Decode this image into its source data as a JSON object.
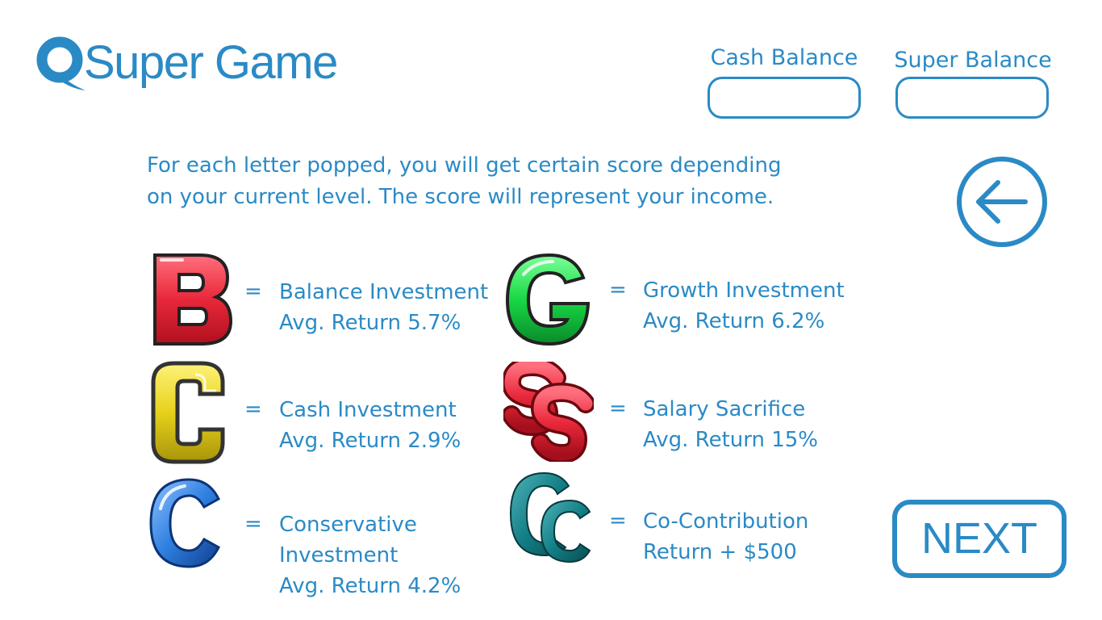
{
  "app": {
    "title": "Super Game"
  },
  "balances": {
    "cash_label": "Cash Balance",
    "cash_value": "",
    "super_label": "Super Balance",
    "super_value": ""
  },
  "intro": {
    "line1": "For each letter popped, you will get certain score depending",
    "line2": "on your current level. The score will represent your income."
  },
  "letters": [
    {
      "letter": "B",
      "icon": "letter-b-icon",
      "color": "#e8283a",
      "equals": "=",
      "lines": [
        "Balance Investment",
        "Avg. Return 5.7%"
      ]
    },
    {
      "letter": "G",
      "icon": "letter-g-icon",
      "color": "#18d845",
      "equals": "=",
      "lines": [
        "Growth Investment",
        "Avg. Return 6.2%"
      ]
    },
    {
      "letter": "C",
      "icon": "letter-c-yellow-icon",
      "color": "#e6d21a",
      "equals": "=",
      "lines": [
        "Cash Investment",
        "Avg. Return 2.9%"
      ]
    },
    {
      "letter": "SS",
      "icon": "letter-ss-icon",
      "color": "#e8283a",
      "equals": "=",
      "lines": [
        "Salary Sacrifice",
        "Avg. Return 15%"
      ]
    },
    {
      "letter": "C",
      "icon": "letter-c-blue-icon",
      "color": "#2f7fe0",
      "equals": "=",
      "lines": [
        "Conservative",
        "Investment",
        "Avg. Return 4.2%"
      ]
    },
    {
      "letter": "CC",
      "icon": "letter-cc-icon",
      "color": "#137f86",
      "equals": "=",
      "lines": [
        "Co-Contribution",
        "Return + $500"
      ]
    }
  ],
  "buttons": {
    "back_icon": "arrow-left-icon",
    "next_label": "NEXT"
  },
  "colors": {
    "accent": "#2a8ac6",
    "background": "#ffffff"
  }
}
